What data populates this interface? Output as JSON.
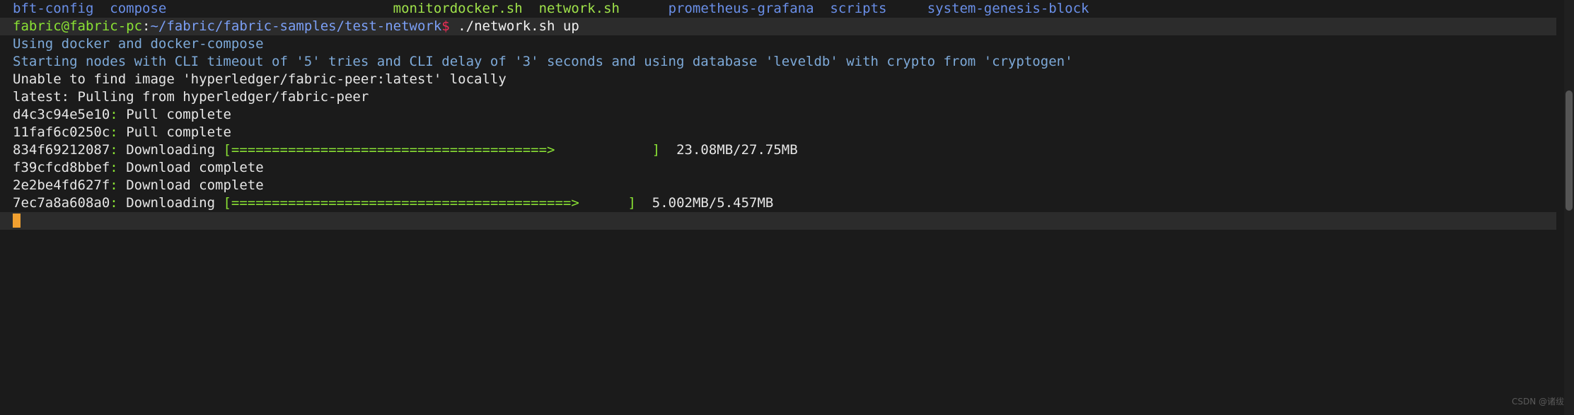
{
  "terminal": {
    "background": "#1b1b1b",
    "foreground": "#d8d8d8",
    "highlight_row_background": "#2c2c2c",
    "cursor_color": "#f0a030"
  },
  "ls_listing": {
    "entries": [
      {
        "name": "bft-config",
        "type": "directory",
        "color": "#6a8fe8"
      },
      {
        "name": "compose",
        "type": "directory",
        "color": "#6a8fe8"
      },
      {
        "name": "monitordocker.sh",
        "type": "executable",
        "color": "#9fe24a"
      },
      {
        "name": "network.sh",
        "type": "executable",
        "color": "#9fe24a"
      },
      {
        "name": "prometheus-grafana",
        "type": "directory",
        "color": "#6a8fe8"
      },
      {
        "name": "scripts",
        "type": "directory",
        "color": "#6a8fe8"
      },
      {
        "name": "system-genesis-block",
        "type": "directory",
        "color": "#6a8fe8"
      }
    ],
    "gap_before_monitordocker": "                            ",
    "gap_before_prometheus": "      ",
    "gap_before_system": "     "
  },
  "prompt": {
    "user_host": "fabric@fabric-pc",
    "separator": ":",
    "path": "~/fabric/fabric-samples/test-network",
    "sigil": "$",
    "command": " ./network.sh up",
    "user_host_color": "#8ae234",
    "path_color": "#7b9ff5",
    "sigil_color": "#ef2d56"
  },
  "output": {
    "lines": [
      {
        "id": "using-docker",
        "style": "info",
        "text": "Using docker and docker-compose"
      },
      {
        "id": "starting-nodes",
        "style": "info",
        "text": "Starting nodes with CLI timeout of '5' tries and CLI delay of '3' seconds and using database 'leveldb' with crypto from 'cryptogen'"
      },
      {
        "id": "unable-to-find",
        "style": "plain",
        "text": "Unable to find image 'hyperledger/fabric-peer:latest' locally"
      },
      {
        "id": "pulling-from",
        "style": "plain",
        "text": "latest: Pulling from hyperledger/fabric-peer"
      }
    ]
  },
  "layers": [
    {
      "id": "d4c3c94e5e10",
      "status": "Pull complete",
      "has_bar": false,
      "bar": "",
      "bar_pad": "",
      "size": ""
    },
    {
      "id": "11faf6c0250c",
      "status": "Pull complete",
      "has_bar": false,
      "bar": "",
      "bar_pad": "",
      "size": ""
    },
    {
      "id": "834f69212087",
      "status": "Downloading",
      "has_bar": true,
      "bar": "[=======================================>",
      "bar_pad": "            ]",
      "size": "  23.08MB/27.75MB"
    },
    {
      "id": "f39cfcd8bbef",
      "status": "Download complete",
      "has_bar": false,
      "bar": "",
      "bar_pad": "",
      "size": ""
    },
    {
      "id": "2e2be4fd627f",
      "status": "Download complete",
      "has_bar": false,
      "bar": "",
      "bar_pad": "",
      "size": ""
    },
    {
      "id": "7ec7a8a608a0",
      "status": "Downloading",
      "has_bar": true,
      "bar": "[==========================================>",
      "bar_pad": "      ]",
      "size": "  5.002MB/5.457MB"
    }
  ],
  "watermark": {
    "text": "CSDN @诸绂"
  }
}
